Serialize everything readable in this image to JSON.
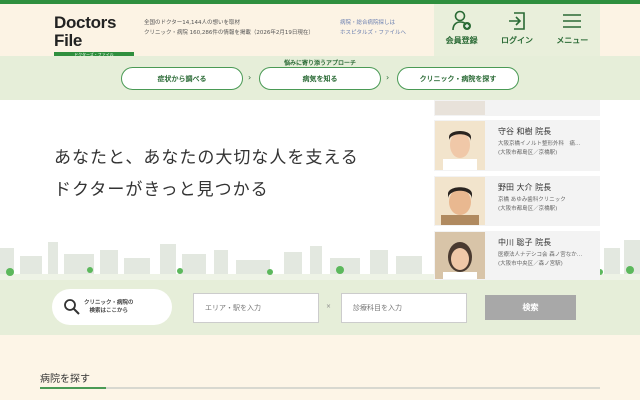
{
  "header": {
    "logo": "Doctors File",
    "logo_sub": "ドクターズ・ファイル",
    "tagline1": "全国のドクター14,144人の想いを取材",
    "tagline2": "クリニック・病院 160,286件の情報を掲載（2026年2月19日現在）",
    "hospital_link1": "病院・総合病院探しは",
    "hospital_link2": "ホスピタルズ・ファイルへ",
    "buttons": [
      {
        "label": "会員登録",
        "icon": "user-add-icon"
      },
      {
        "label": "ログイン",
        "icon": "login-icon"
      },
      {
        "label": "メニュー",
        "icon": "menu-icon"
      }
    ]
  },
  "nav": {
    "title": "悩みに寄り添うアプローチ",
    "steps": [
      "症状から調べる",
      "病気を知る",
      "クリニック・病院を探す"
    ]
  },
  "hero": {
    "line1": "あなたと、あなたの大切な人を支える",
    "line2": "ドクターがきっと見つかる"
  },
  "doctors": [
    {
      "name": "守谷 和樹 院長",
      "clinic": "大阪京橋イノルト整形外科　痛…",
      "area": "(大阪市都島区／京橋駅)"
    },
    {
      "name": "野田 大介 院長",
      "clinic": "京橋 あゆみ歯科クリニック",
      "area": "(大阪市都島区／京橋駅)"
    },
    {
      "name": "中川 聡子 院長",
      "clinic": "医療法人ナデシコ会 森ノ宮なか…",
      "area": "(大阪市中央区／森ノ宮駅)"
    }
  ],
  "search": {
    "bubble1": "クリニック・病院の",
    "bubble2": "検索はここから",
    "area_placeholder": "エリア・駅を入力",
    "separator": "×",
    "dept_placeholder": "診療科目を入力",
    "button": "検索"
  },
  "section": {
    "title": "病院を探す"
  },
  "colors": {
    "brand": "#2f8f3e",
    "band": "#e6eed9",
    "cream": "#fdf5e7"
  }
}
